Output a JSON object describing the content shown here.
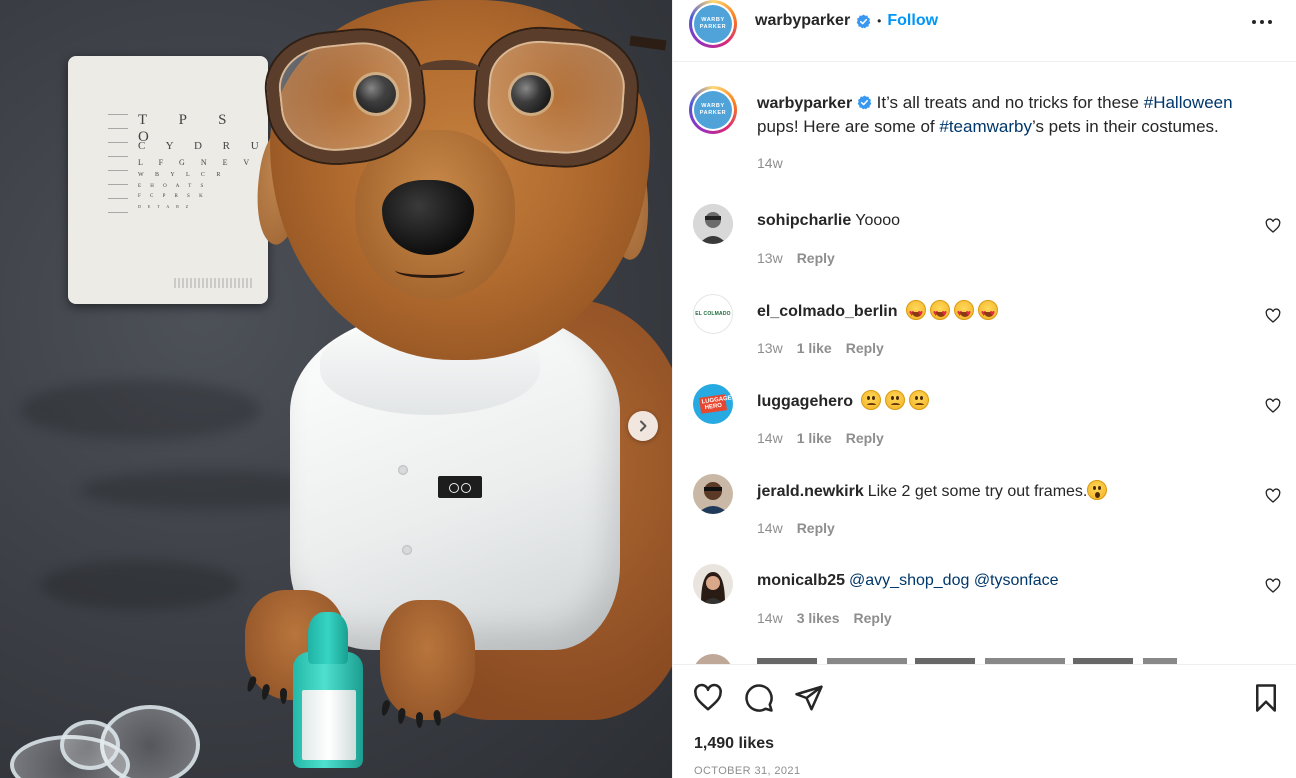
{
  "post": {
    "image_alt": "Dachshund wearing glasses and a white doctor's coat",
    "eye_chart": {
      "row1": "T P S O",
      "row2": "C Y D R U",
      "row3": "L F G N E V",
      "row4": "W B Y L C R",
      "row5": "E H O A T S",
      "row6": "F C P R S K",
      "row7": "D E T A B Z"
    }
  },
  "header": {
    "username": "warbyparker",
    "separator": "•",
    "follow_label": "Follow",
    "more_icon": "more-horizontal-icon",
    "logo_line1": "WARBY",
    "logo_line2": "PARKER"
  },
  "caption": {
    "username": "warbyparker",
    "text_part1": "It’s all treats and no tricks for these ",
    "hashtag1": "#Halloween",
    "text_part2": " pups! Here are some of ",
    "hashtag2": "#teamwarby",
    "text_part3": "’s pets in their costumes.",
    "time": "14w"
  },
  "comments": [
    {
      "username": "sohipcharlie",
      "text": "Yoooo",
      "time": "13w",
      "likes": "",
      "reply": "Reply"
    },
    {
      "username": "el_colmado_berlin",
      "text": "",
      "emojis": [
        "heart-eyes",
        "heart-eyes",
        "heart-eyes",
        "heart-eyes"
      ],
      "time": "13w",
      "likes": "1 like",
      "reply": "Reply",
      "avatar_text": "EL COLMADO"
    },
    {
      "username": "luggagehero",
      "text": "",
      "emojis": [
        "worried",
        "worried",
        "worried"
      ],
      "time": "14w",
      "likes": "1 like",
      "reply": "Reply",
      "avatar_text": "LUGGAGE HERO"
    },
    {
      "username": "jerald.newkirk",
      "text": "Like 2 get some try out frames.",
      "emojis": [
        "astonished"
      ],
      "time": "14w",
      "likes": "",
      "reply": "Reply"
    },
    {
      "username": "monicalb25",
      "mention1": "@avy_shop_dog",
      "mention2": "@tysonface",
      "time": "14w",
      "likes": "3 likes",
      "reply": "Reply"
    }
  ],
  "actions": {
    "like_icon": "heart-outline-icon",
    "comment_icon": "comment-bubble-icon",
    "share_icon": "paper-plane-icon",
    "save_icon": "bookmark-icon"
  },
  "likes_count": "1,490 likes",
  "date": "OCTOBER 31, 2021",
  "colors": {
    "follow": "#0095f6",
    "link": "#00376b",
    "meta": "#8e8e8e",
    "brand": "#4fa3d8"
  }
}
